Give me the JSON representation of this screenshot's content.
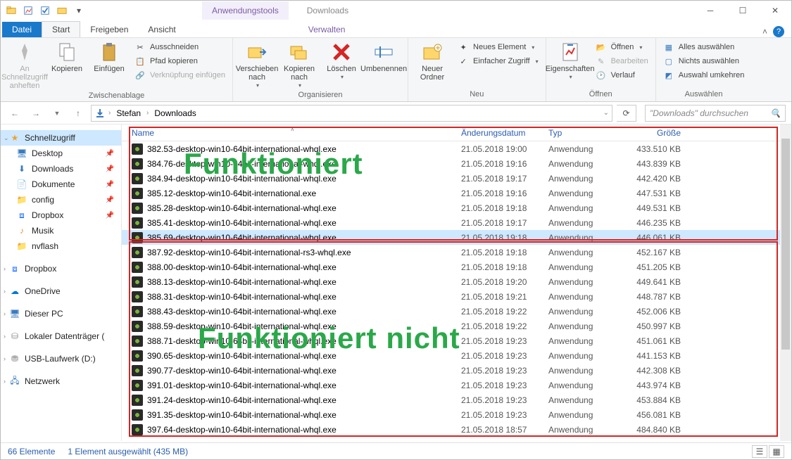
{
  "titlebar": {
    "context_tab": "Anwendungstools",
    "window_title": "Downloads"
  },
  "ribbon_tabs": {
    "file": "Datei",
    "home": "Start",
    "share": "Freigeben",
    "view": "Ansicht",
    "manage": "Verwalten"
  },
  "ribbon": {
    "pin": "An Schnellzugriff anheften",
    "copy": "Kopieren",
    "paste": "Einfügen",
    "cut": "Ausschneiden",
    "copypath": "Pfad kopieren",
    "pasteshortcut": "Verknüpfung einfügen",
    "group_clipboard": "Zwischenablage",
    "moveto": "Verschieben nach",
    "copyto": "Kopieren nach",
    "delete": "Löschen",
    "rename": "Umbenennen",
    "group_organize": "Organisieren",
    "newfolder": "Neuer Ordner",
    "newitem": "Neues Element",
    "easyaccess": "Einfacher Zugriff",
    "group_new": "Neu",
    "properties": "Eigenschaften",
    "open": "Öffnen",
    "edit": "Bearbeiten",
    "history": "Verlauf",
    "group_open": "Öffnen",
    "selectall": "Alles auswählen",
    "selectnone": "Nichts auswählen",
    "invert": "Auswahl umkehren",
    "group_select": "Auswählen"
  },
  "breadcrumb": {
    "parts": [
      "Stefan",
      "Downloads"
    ]
  },
  "search": {
    "placeholder": "\"Downloads\" durchsuchen"
  },
  "nav": {
    "quick": "Schnellzugriff",
    "desktop": "Desktop",
    "downloads": "Downloads",
    "documents": "Dokumente",
    "config": "config",
    "dropbox_pin": "Dropbox",
    "music": "Musik",
    "nvflash": "nvflash",
    "dropbox": "Dropbox",
    "onedrive": "OneDrive",
    "thispc": "Dieser PC",
    "localdisk": "Lokaler Datenträger (",
    "usb": "USB-Laufwerk (D:)",
    "network": "Netzwerk"
  },
  "columns": {
    "name": "Name",
    "date": "Änderungsdatum",
    "type": "Typ",
    "size": "Größe"
  },
  "files": [
    {
      "name": "382.53-desktop-win10-64bit-international-whql.exe",
      "date": "21.05.2018 19:00",
      "type": "Anwendung",
      "size": "433.510 KB",
      "sel": false
    },
    {
      "name": "384.76-desktop-win10-64bit-international-whql.exe",
      "date": "21.05.2018 19:16",
      "type": "Anwendung",
      "size": "443.839 KB",
      "sel": false
    },
    {
      "name": "384.94-desktop-win10-64bit-international-whql.exe",
      "date": "21.05.2018 19:17",
      "type": "Anwendung",
      "size": "442.420 KB",
      "sel": false
    },
    {
      "name": "385.12-desktop-win10-64bit-international.exe",
      "date": "21.05.2018 19:16",
      "type": "Anwendung",
      "size": "447.531 KB",
      "sel": false
    },
    {
      "name": "385.28-desktop-win10-64bit-international-whql.exe",
      "date": "21.05.2018 19:18",
      "type": "Anwendung",
      "size": "449.531 KB",
      "sel": false
    },
    {
      "name": "385.41-desktop-win10-64bit-international-whql.exe",
      "date": "21.05.2018 19:17",
      "type": "Anwendung",
      "size": "446.235 KB",
      "sel": false
    },
    {
      "name": "385.69-desktop-win10-64bit-international-whql.exe",
      "date": "21.05.2018 19:18",
      "type": "Anwendung",
      "size": "446.061 KB",
      "sel": true
    },
    {
      "name": "387.92-desktop-win10-64bit-international-rs3-whql.exe",
      "date": "21.05.2018 19:18",
      "type": "Anwendung",
      "size": "452.167 KB",
      "sel": false
    },
    {
      "name": "388.00-desktop-win10-64bit-international-whql.exe",
      "date": "21.05.2018 19:18",
      "type": "Anwendung",
      "size": "451.205 KB",
      "sel": false
    },
    {
      "name": "388.13-desktop-win10-64bit-international-whql.exe",
      "date": "21.05.2018 19:20",
      "type": "Anwendung",
      "size": "449.641 KB",
      "sel": false
    },
    {
      "name": "388.31-desktop-win10-64bit-international-whql.exe",
      "date": "21.05.2018 19:21",
      "type": "Anwendung",
      "size": "448.787 KB",
      "sel": false
    },
    {
      "name": "388.43-desktop-win10-64bit-international-whql.exe",
      "date": "21.05.2018 19:22",
      "type": "Anwendung",
      "size": "452.006 KB",
      "sel": false
    },
    {
      "name": "388.59-desktop-win10-64bit-international-whql.exe",
      "date": "21.05.2018 19:22",
      "type": "Anwendung",
      "size": "450.997 KB",
      "sel": false
    },
    {
      "name": "388.71-desktop-win10-64bit-international-whql.exe",
      "date": "21.05.2018 19:23",
      "type": "Anwendung",
      "size": "451.061 KB",
      "sel": false
    },
    {
      "name": "390.65-desktop-win10-64bit-international-whql.exe",
      "date": "21.05.2018 19:23",
      "type": "Anwendung",
      "size": "441.153 KB",
      "sel": false
    },
    {
      "name": "390.77-desktop-win10-64bit-international-whql.exe",
      "date": "21.05.2018 19:23",
      "type": "Anwendung",
      "size": "442.308 KB",
      "sel": false
    },
    {
      "name": "391.01-desktop-win10-64bit-international-whql.exe",
      "date": "21.05.2018 19:23",
      "type": "Anwendung",
      "size": "443.974 KB",
      "sel": false
    },
    {
      "name": "391.24-desktop-win10-64bit-international-whql.exe",
      "date": "21.05.2018 19:23",
      "type": "Anwendung",
      "size": "453.884 KB",
      "sel": false
    },
    {
      "name": "391.35-desktop-win10-64bit-international-whql.exe",
      "date": "21.05.2018 19:23",
      "type": "Anwendung",
      "size": "456.081 KB",
      "sel": false
    },
    {
      "name": "397.64-desktop-win10-64bit-international-whql.exe",
      "date": "21.05.2018 18:57",
      "type": "Anwendung",
      "size": "484.840 KB",
      "sel": false
    }
  ],
  "annotations": {
    "works": "Funktioniert",
    "notworks": "Funktioniert nicht"
  },
  "status": {
    "count": "66 Elemente",
    "selected": "1 Element ausgewählt (435 MB)"
  }
}
